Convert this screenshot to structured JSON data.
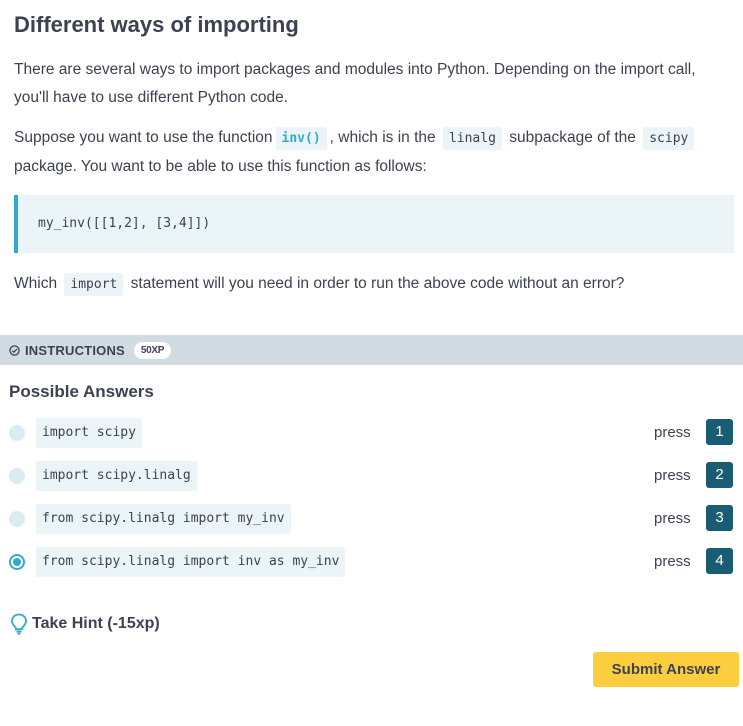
{
  "exercise": {
    "title": "Different ways of importing",
    "p1": "There are several ways to import packages and modules into Python. Depending on the import call, you'll have to use different Python code.",
    "p2_a": "Suppose you want to use the function",
    "p2_code1": "inv()",
    "p2_b": ", which is in the",
    "p2_code2": "linalg",
    "p2_c": "subpackage of the",
    "p2_code3": "scipy",
    "p2_d": "package. You want to be able to use this function as follows:",
    "code_block": "my_inv([[1,2], [3,4]])",
    "p4_a": "Which",
    "p4_code": "import",
    "p4_b": "statement will you need in order to run the above code without an error?"
  },
  "instructions": {
    "label": "INSTRUCTIONS",
    "xp": "50XP"
  },
  "answers": {
    "title": "Possible Answers",
    "press_label": "press",
    "items": [
      {
        "text": "import scipy",
        "key": "1",
        "selected": false
      },
      {
        "text": "import scipy.linalg",
        "key": "2",
        "selected": false
      },
      {
        "text": "from scipy.linalg import my_inv",
        "key": "3",
        "selected": false
      },
      {
        "text": "from scipy.linalg import inv as my_inv",
        "key": "4",
        "selected": true
      }
    ]
  },
  "hint": {
    "label": "Take Hint (-15xp)"
  },
  "submit": {
    "label": "Submit Answer"
  },
  "colors": {
    "accent": "#33aacc",
    "key_bg": "#1a5c74",
    "submit_bg": "#fcce3f",
    "instructions_bg": "#d1dce2",
    "code_bg": "#ebf4f7"
  }
}
